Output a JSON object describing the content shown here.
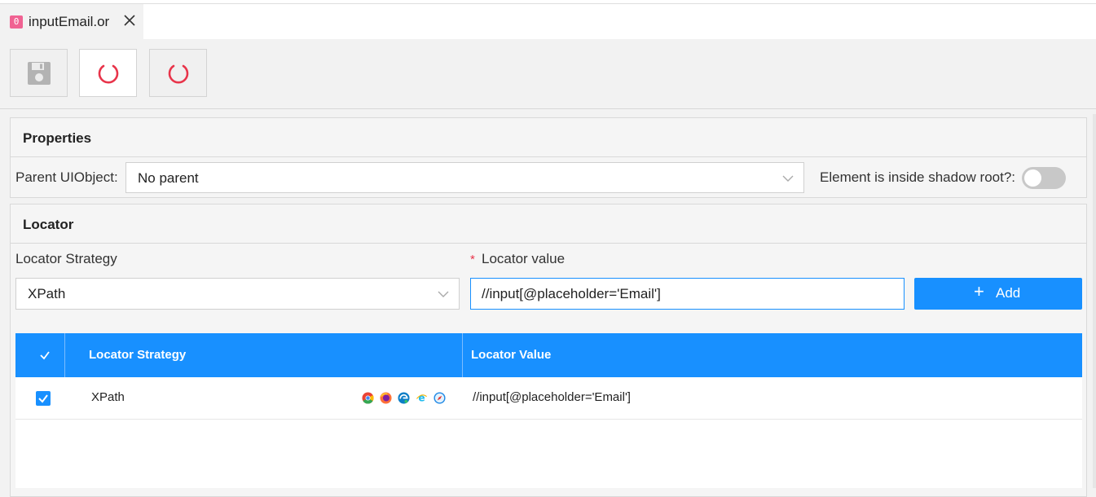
{
  "tab": {
    "badge": "0",
    "title": "inputEmail.or"
  },
  "toolbar": {
    "buttons": [
      "save",
      "refresh",
      "reload"
    ]
  },
  "properties": {
    "title": "Properties",
    "parent_label": "Parent UIObject:",
    "parent_value": "No parent",
    "shadow_label": "Element is inside shadow root?:",
    "shadow_enabled": false
  },
  "locator": {
    "title": "Locator",
    "strategy_label": "Locator Strategy",
    "strategy_value": "XPath",
    "required_mark": "*",
    "value_label": "Locator value",
    "value_input": "//input[@placeholder='Email']",
    "add_label": "Add"
  },
  "table": {
    "headers": [
      "Locator Strategy",
      "Locator Value"
    ],
    "rows": [
      {
        "checked": true,
        "strategy": "XPath",
        "browsers": [
          "chrome-icon",
          "firefox-icon",
          "edge-icon",
          "ie-icon",
          "safari-icon"
        ],
        "value": "//input[@placeholder='Email']"
      }
    ]
  },
  "colors": {
    "primary": "#1890ff",
    "refresh": "#e8344a",
    "badge": "#f06292"
  }
}
